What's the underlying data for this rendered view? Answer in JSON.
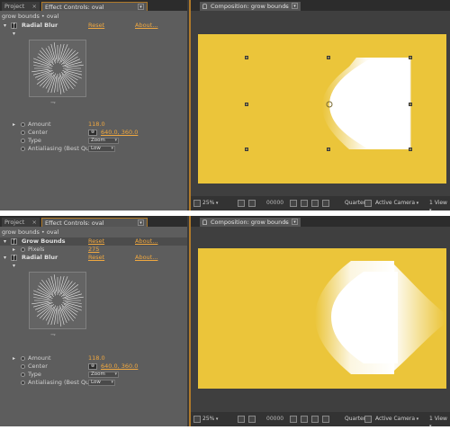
{
  "colors": {
    "comp_bg": "#ebc53a",
    "accent": "#f0a840",
    "panel": "#5d5d5d"
  },
  "panels": [
    {
      "tabs": {
        "project": "Project",
        "effect_controls": "Effect Controls: oval"
      },
      "layer_path": "grow bounds • oval",
      "effects": [
        {
          "name": "Radial Blur",
          "reset": "Reset",
          "about": "About...",
          "params": {
            "amount_label": "Amount",
            "amount_value": "118.0",
            "center_label": "Center",
            "center_value": "640.0, 360.0",
            "type_label": "Type",
            "type_value": "Zoom",
            "aa_label": "Antialiasing (Best Quali",
            "aa_value": "Low"
          }
        }
      ],
      "comp": {
        "tab": "Composition: grow bounds",
        "zoom": "25%",
        "timecode": "00000",
        "resolution": "Quarter",
        "camera": "Active Camera",
        "views": "1 View"
      }
    },
    {
      "tabs": {
        "project": "Project",
        "effect_controls": "Effect Controls: oval"
      },
      "layer_path": "grow bounds • oval",
      "effects": [
        {
          "name": "Grow Bounds",
          "reset": "Reset",
          "about": "About...",
          "params": {
            "pixels_label": "Pixels",
            "pixels_value": "275"
          }
        },
        {
          "name": "Radial Blur",
          "reset": "Reset",
          "about": "About...",
          "params": {
            "amount_label": "Amount",
            "amount_value": "118.0",
            "center_label": "Center",
            "center_value": "640.0, 360.0",
            "type_label": "Type",
            "type_value": "Zoom",
            "aa_label": "Antialiasing (Best Quali",
            "aa_value": "Low"
          }
        }
      ],
      "comp": {
        "tab": "Composition: grow bounds",
        "zoom": "25%",
        "timecode": "00000",
        "resolution": "Quarter",
        "camera": "Active Camera",
        "views": "1 View"
      }
    }
  ]
}
